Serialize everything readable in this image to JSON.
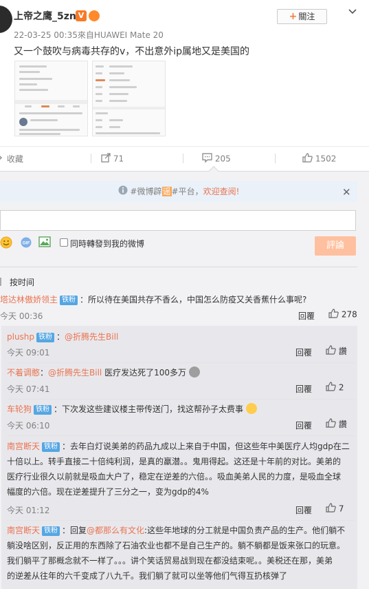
{
  "post": {
    "username": "上帝之鹰_5zn",
    "verified_badge": "V",
    "follow_label": "關注",
    "meta": "22-03-25 00:35來自HUAWEI Mate 20",
    "text": "又一个鼓吹与病毒共存的v，不出意外ip属地又是美国的"
  },
  "actions": {
    "favorite": "收藏",
    "forward_count": "71",
    "comment_count": "205",
    "like_count": "1502"
  },
  "notice": {
    "prefix": "#微博",
    "mid_a": "辟",
    "mid_b": "谣",
    "suffix": "#平台，",
    "link": "欢迎查阅!"
  },
  "composer": {
    "forward_label": "同時轉發到我的微博",
    "submit_label": "評論"
  },
  "sort_label": "按时间",
  "comments": [
    {
      "user": "塔达林傲娇领主",
      "tag": "铁粉",
      "text": "：所以待在美国共存不香么，中国怎么防疫又关香蕉什么事呢?",
      "time": "今天 00:36",
      "reply": "回覆",
      "likes": "278"
    },
    {
      "user": "plushp",
      "tag": "铁粉",
      "colon": "：",
      "mention": "@折腾先生Bill",
      "time": "今天 09:01",
      "reply": "回覆",
      "likes": "讚"
    },
    {
      "user": "不着调憨",
      "colon": "：",
      "mention": "@折腾先生Bill",
      "text": " 医疗发达死了100多万",
      "time": "今天 07:41",
      "reply": "回覆",
      "likes": "2"
    },
    {
      "user": "车轮狗",
      "tag": "铁粉",
      "text": "：下次发这些建议楼主带传送门，找这帮孙子太费事",
      "time": "今天 06:10",
      "reply": "回覆",
      "likes": "讚"
    },
    {
      "user": "南宫断天",
      "tag": "铁粉",
      "line1": "：去年白灯说美弟的药品九成以上来自于中国，但这些年中美医疗人均gdp在二",
      "line2": "十倍以上。转手直接二十倍纯利润，是真的羸潜。。鬼用得起。这还是十年前的对比。美弟的",
      "line3": "医疗行业很久以前就是吸血大户了，稳定在逆差的六倍。。吸血美弟人民的力度，是吸血全球",
      "line4": "幅度的六倍。现在逆差提升了三分之一，变为gdp的4%",
      "time": "今天 01:12",
      "reply": "回覆",
      "likes": "7"
    },
    {
      "user": "南宫断天",
      "tag": "铁粉",
      "reply_prefix": "：回复",
      "mention": "@都那么有文化",
      "line1": ":这些年地球的分工就是中国负责产品的生产。他们躺不",
      "line2": "躺没啥区别，反正用的东西除了石油农业也都不是自己生产的。躺不躺都是饭来张口的玩意。",
      "line3": "我们躺平了那概念就不一样了。。。讲个笑话贸易战到现在都没结束呢。。美税还在那，美弟",
      "line4": "的逆差从往年的六千变成了八九千。我们躺了就可以坐等他们气得互扔核弹了"
    }
  ]
}
